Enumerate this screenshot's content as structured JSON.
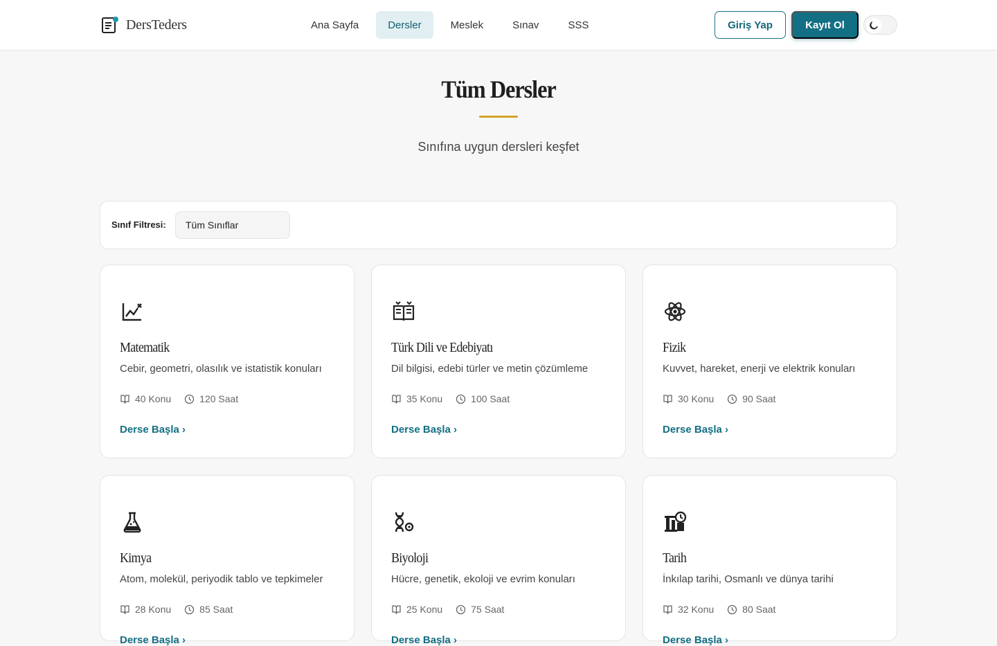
{
  "header": {
    "logo_text": "DersTeders",
    "nav": [
      {
        "label": "Ana Sayfa",
        "active": false
      },
      {
        "label": "Dersler",
        "active": true
      },
      {
        "label": "Meslek",
        "active": false
      },
      {
        "label": "Sınav",
        "active": false
      },
      {
        "label": "SSS",
        "active": false
      }
    ],
    "login_label": "Giriş Yap",
    "register_label": "Kayıt Ol",
    "theme_toggle_icon": "moon-icon"
  },
  "hero": {
    "title": "Tüm Dersler",
    "subtitle": "Sınıfına uygun dersleri keşfet"
  },
  "filter": {
    "label": "Sınıf Filtresi:",
    "selected": "Tüm Sınıflar"
  },
  "colors": {
    "accent": "#136f84",
    "divider_gold": "#d4a22a"
  },
  "courses": [
    {
      "icon": "chart-line-icon",
      "title": "Matematik",
      "description": "Cebir, geometri, olasılık ve istatistik konuları",
      "topics": "40 Konu",
      "hours": "120 Saat",
      "cta": "Derse Başla ›"
    },
    {
      "icon": "book-open-icon",
      "title": "Türk Dili ve Edebiyatı",
      "description": "Dil bilgisi, edebi türler ve metin çözümleme",
      "topics": "35 Konu",
      "hours": "100 Saat",
      "cta": "Derse Başla ›"
    },
    {
      "icon": "atom-icon",
      "title": "Fizik",
      "description": "Kuvvet, hareket, enerji ve elektrik konuları",
      "topics": "30 Konu",
      "hours": "90 Saat",
      "cta": "Derse Başla ›"
    },
    {
      "icon": "flask-icon",
      "title": "Kimya",
      "description": "Atom, molekül, periyodik tablo ve tepkimeler",
      "topics": "28 Konu",
      "hours": "85 Saat",
      "cta": "Derse Başla ›"
    },
    {
      "icon": "dna-icon",
      "title": "Biyoloji",
      "description": "Hücre, genetik, ekoloji ve evrim konuları",
      "topics": "25 Konu",
      "hours": "75 Saat",
      "cta": "Derse Başla ›"
    },
    {
      "icon": "history-landmark-icon",
      "title": "Tarih",
      "description": "İnkılap tarihi, Osmanlı ve dünya tarihi",
      "topics": "32 Konu",
      "hours": "80 Saat",
      "cta": "Derse Başla ›"
    }
  ]
}
